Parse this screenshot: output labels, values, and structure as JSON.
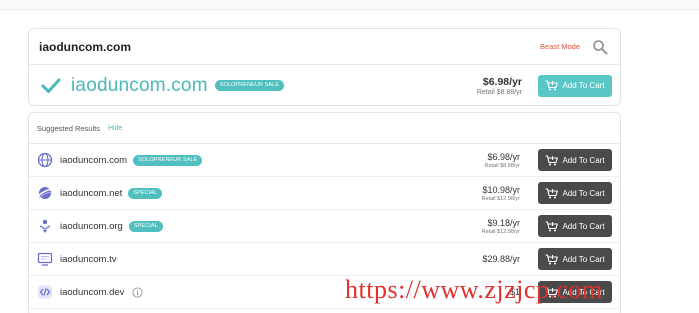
{
  "search": {
    "query": "iaoduncom.com",
    "beast_mode": "Beast Mode"
  },
  "main_result": {
    "domain": "iaoduncom.com",
    "badge": "SOLOPRENEUR SALE",
    "price": "$6.98/yr",
    "retail": "Retail $8.88/yr",
    "cart_label": "Add To Cart"
  },
  "suggested": {
    "title": "Suggested Results",
    "hide": "Hide",
    "rows": [
      {
        "domain": "iaoduncom.com",
        "badge": "SOLOPRENEUR SALE",
        "price": "$6.98/yr",
        "retail": "Retail $8.88/yr",
        "cart_label": "Add To Cart",
        "icon": "globe-icon"
      },
      {
        "domain": "iaoduncom.net",
        "badge": "SPECIAL",
        "price": "$10.98/yr",
        "retail": "Retail $12.98/yr",
        "cart_label": "Add To Cart",
        "icon": "net-planet-icon"
      },
      {
        "domain": "iaoduncom.org",
        "badge": "SPECIAL",
        "price": "$9.18/yr",
        "retail": "Retail $12.98/yr",
        "cart_label": "Add To Cart",
        "icon": "org-people-icon"
      },
      {
        "domain": "iaoduncom.tv",
        "badge": "",
        "price": "$29.88/yr",
        "retail": "",
        "cart_label": "Add To Cart",
        "icon": "tv-icon"
      },
      {
        "domain": "iaoduncom.dev",
        "badge": "",
        "price": "$1",
        "retail": "",
        "cart_label": "Add To Cart",
        "icon": "code-icon"
      }
    ]
  },
  "watermark": "https://www.zjzjcp.com",
  "colors": {
    "teal": "#49b9b9",
    "accent_red": "#e0523d",
    "dark_button": "#4a4a4a"
  }
}
